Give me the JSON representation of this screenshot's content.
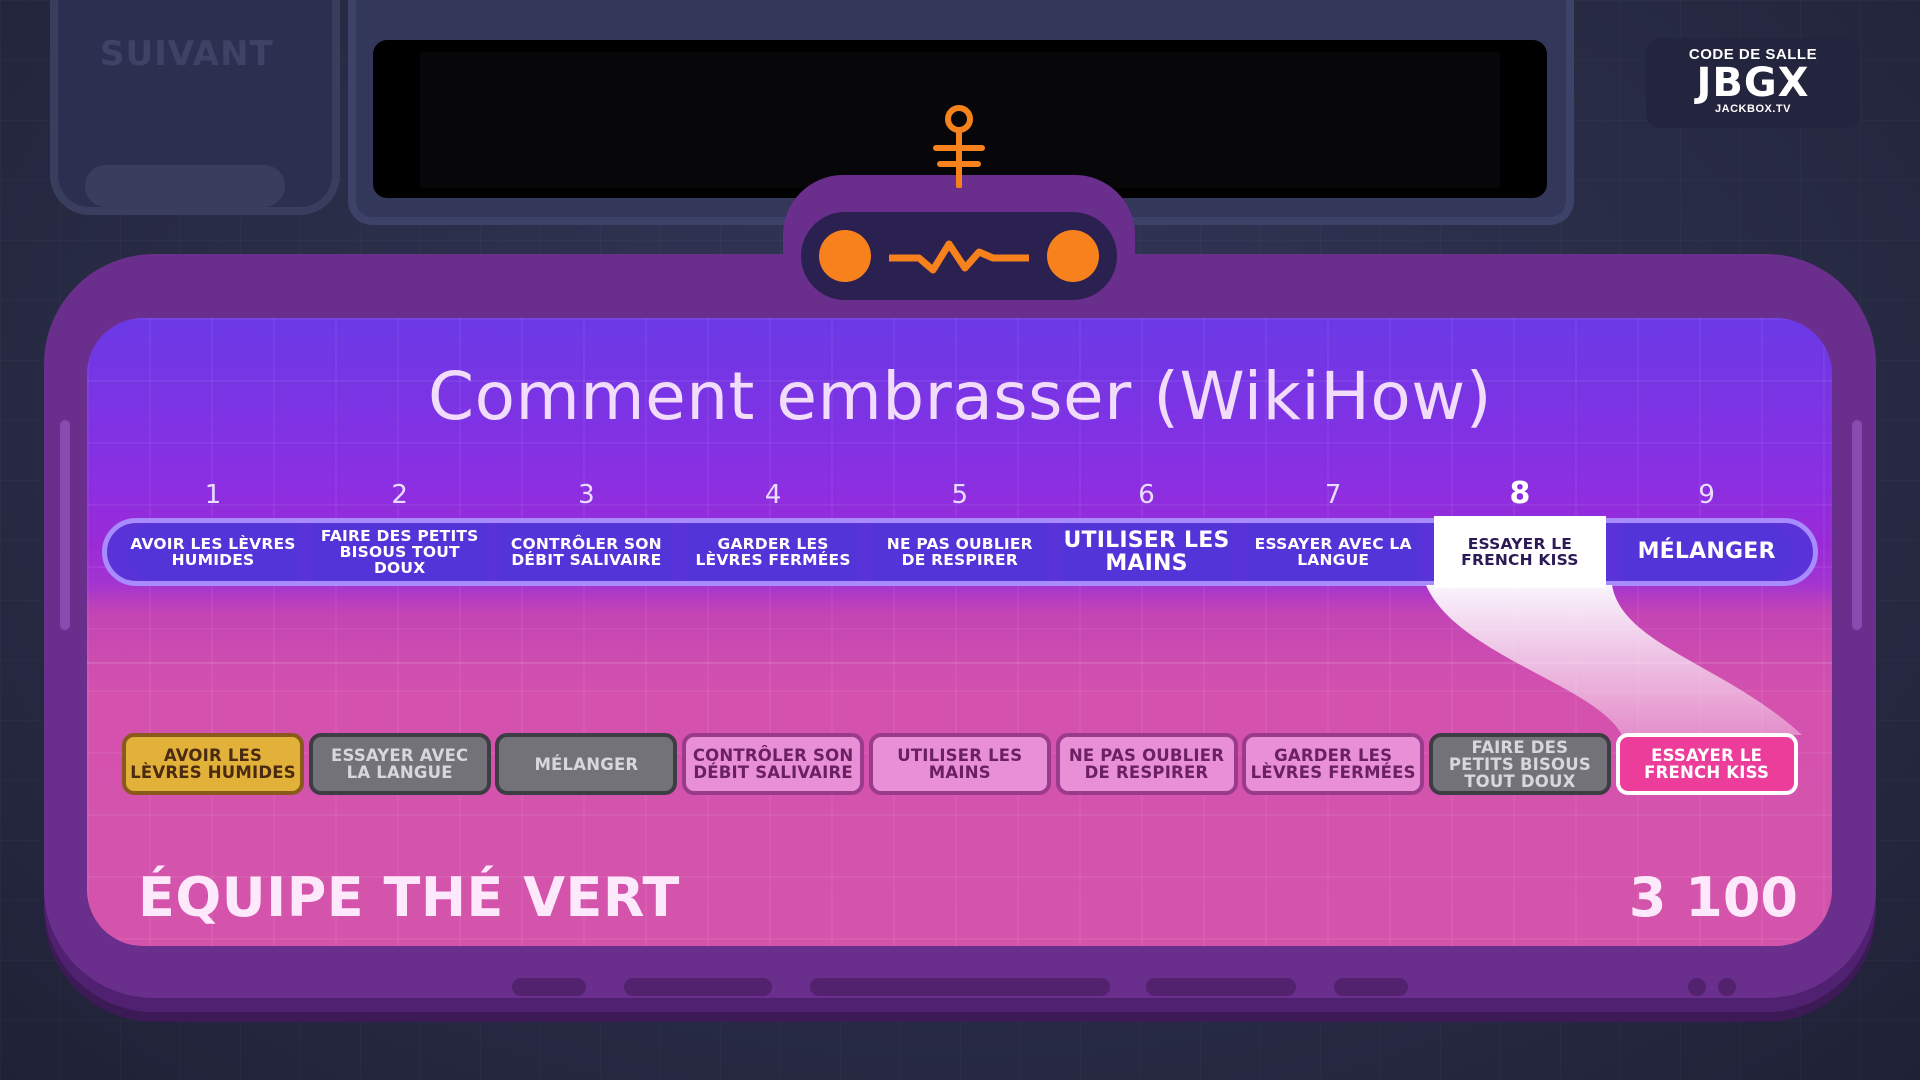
{
  "hud": {
    "next_label": "SUIVANT",
    "room_code_label": "CODE DE SALLE",
    "room_code": "JBGX",
    "site": "JACKBOX.TV"
  },
  "question": {
    "title": "Comment embrasser (WikiHow)"
  },
  "sequence": {
    "numbers": [
      "1",
      "2",
      "3",
      "4",
      "5",
      "6",
      "7",
      "8",
      "9"
    ],
    "steps": [
      "AVOIR LES LÈVRES HUMIDES",
      "FAIRE DES PETITS BISOUS TOUT DOUX",
      "CONTRÔLER SON DÉBIT SALIVAIRE",
      "GARDER LES LÈVRES FERMÉES",
      "NE PAS OUBLIER DE RESPIRER",
      "UTILISER LES MAINS",
      "ESSAYER AVEC LA LANGUE",
      "ESSAYER LE FRENCH KISS",
      "MÉLANGER"
    ],
    "selected_index": 7
  },
  "answers": [
    {
      "label": "AVOIR LES LÈVRES HUMIDES",
      "status": "gold"
    },
    {
      "label": "ESSAYER AVEC LA LANGUE",
      "status": "grey"
    },
    {
      "label": "MÉLANGER",
      "status": "grey"
    },
    {
      "label": "CONTRÔLER SON DÉBIT SALIVAIRE",
      "status": "pink"
    },
    {
      "label": "UTILISER LES MAINS",
      "status": "pink"
    },
    {
      "label": "NE PAS OUBLIER DE RESPIRER",
      "status": "pink"
    },
    {
      "label": "GARDER LES LÈVRES FERMÉES",
      "status": "pink"
    },
    {
      "label": "FAIRE DES PETITS BISOUS TOUT DOUX",
      "status": "grey"
    },
    {
      "label": "ESSAYER LE FRENCH KISS",
      "status": "hot"
    }
  ],
  "team": {
    "name": "ÉQUIPE THÉ VERT",
    "score": "3 100"
  },
  "colors": {
    "accent_orange": "#f7811c",
    "panel_purple": "#8a2fe2",
    "panel_pink": "#d454ac",
    "gold": "#e2b13a"
  }
}
